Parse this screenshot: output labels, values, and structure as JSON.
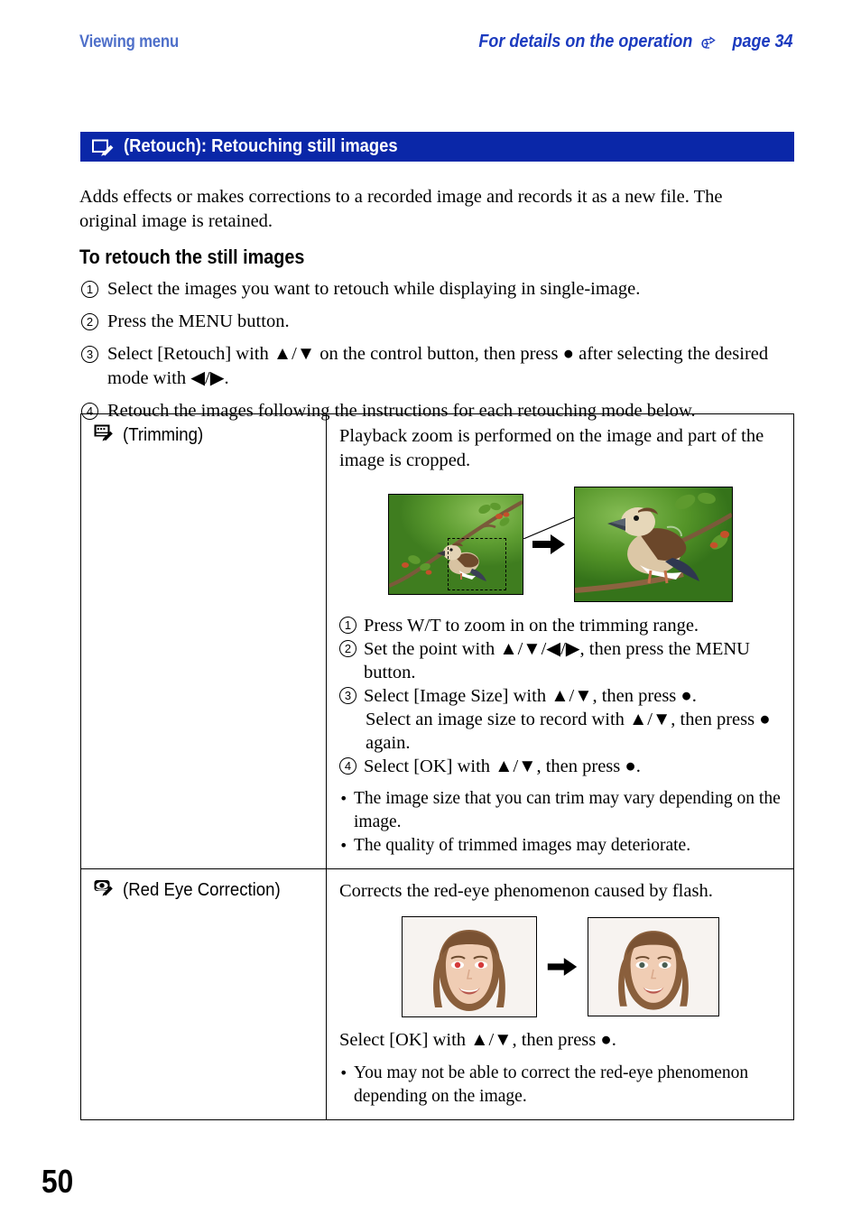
{
  "header": {
    "left_title": "Viewing menu",
    "right_title": "For details on the operation",
    "right_page_ref": "page 34",
    "hand_icon": "pointing-hand-icon"
  },
  "banner": {
    "icon": "retouch-icon",
    "title": "(Retouch): Retouching still images",
    "color": "#0a27a8"
  },
  "intro": "Adds effects or makes corrections to a recorded image and records it as a new file. The original image is retained.",
  "subhead": "To retouch the still images",
  "steps": [
    {
      "num": "1",
      "text": "Select the images you want to retouch while displaying in single-image."
    },
    {
      "num": "2",
      "text": "Press the MENU button."
    },
    {
      "num": "3",
      "text": "Select [Retouch] with ▲/▼ on the control button, then press ● after selecting the desired mode with ◀/▶."
    },
    {
      "num": "4",
      "text": "Retouch the images following the instructions for each retouching mode below."
    }
  ],
  "table": {
    "rows": [
      {
        "mode_icon": "trimming-icon",
        "mode_label": "(Trimming)",
        "description": "Playback zoom is performed on the image and part of the image is cropped.",
        "figure": {
          "left_image": "bird-on-branch-wide-photo",
          "right_image": "bird-on-branch-zoomed-photo",
          "arrow": "right-arrow-icon",
          "crop_box": "dashed-crop-selection"
        },
        "substeps": [
          {
            "num": "1",
            "text": "Press W/T to zoom in on the trimming range."
          },
          {
            "num": "2",
            "text": "Set the point with ▲/▼/◀/▶, then press the MENU button."
          },
          {
            "num": "3",
            "text": "Select [Image Size] with ▲/▼, then press ●.",
            "continuation": "Select an image size to record with ▲/▼, then press ● again."
          },
          {
            "num": "4",
            "text": "Select [OK] with ▲/▼, then press ●."
          }
        ],
        "bullets": [
          "The image size that you can trim may vary depending on the image.",
          "The quality of trimmed images may deteriorate."
        ]
      },
      {
        "mode_icon": "red-eye-correction-icon",
        "mode_label": "(Red Eye Correction)",
        "description": "Corrects the red-eye phenomenon caused by flash.",
        "figure": {
          "left_image": "portrait-with-red-eyes-photo",
          "right_image": "portrait-with-corrected-eyes-photo",
          "arrow": "right-arrow-icon"
        },
        "ok_text": "Select [OK] with ▲/▼, then press ●.",
        "bullets": [
          "You may not be able to correct the red-eye phenomenon depending on the image."
        ]
      }
    ]
  },
  "footer": {
    "page_number": "50"
  }
}
